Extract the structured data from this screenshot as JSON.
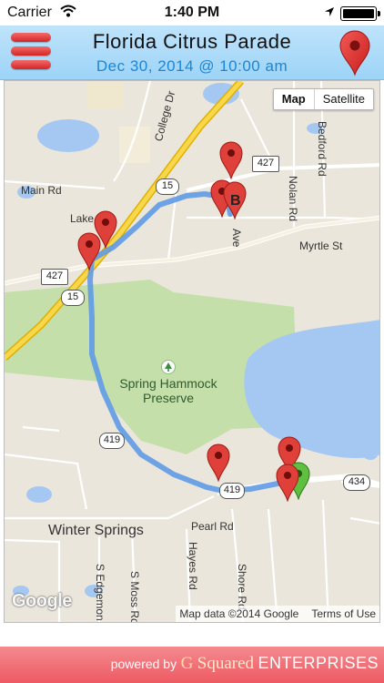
{
  "status_bar": {
    "carrier": "Carrier",
    "time": "1:40 PM",
    "icons": [
      "wifi-icon",
      "location-arrow-icon",
      "battery-icon"
    ]
  },
  "header": {
    "menu_icon": "hamburger-menu-icon",
    "title": "Florida Citrus Parade",
    "subtitle": "Dec 30, 2014 @ 10:00 am",
    "map_pin_icon": "map-pin-icon",
    "colors": {
      "background": "#aedbf8",
      "menu_red": "#d42424",
      "subtitle_blue": "#1d86d4"
    }
  },
  "map": {
    "type_control": {
      "map_label": "Map",
      "satellite_label": "Satellite",
      "selected": "Map"
    },
    "labels": {
      "college_dr": "College Dr",
      "main_rd": "Main Rd",
      "lake": "Lake",
      "bedford_rd": "Bedford Rd",
      "nolan_rd": "Nolan Rd",
      "myrtle_st": "Myrtle St",
      "ave": "Ave",
      "park_line1": "Spring Hammock",
      "park_line2": "Preserve",
      "winter_springs": "Winter Springs",
      "pearl_rd": "Pearl Rd",
      "hayes_rd": "Hayes Rd",
      "shore_rd": "Shore Rd",
      "s_moss_rd": "S Moss Rd",
      "s_edgemon": "S Edgemon"
    },
    "route_shields": {
      "r15_top": "15",
      "r427_top": "427",
      "r427_left": "427",
      "r15_left": "15",
      "r419_mid": "419",
      "r419_bottom": "419",
      "r434": "434"
    },
    "marker_b_label": "B",
    "google_logo": "Google",
    "attribution": {
      "map_data": "Map data ©2014 Google",
      "terms": "Terms of Use"
    },
    "colors": {
      "route": "#6fa8ea",
      "water": "#a5c8f2",
      "park": "#c4dfa9",
      "marker_red": "#e0403a",
      "marker_green": "#5fbf3f"
    }
  },
  "footer": {
    "powered_by": "powered by",
    "brand_g": "G",
    "brand_squared": "Squared",
    "brand_enterprises": "ENTERPRISES"
  }
}
